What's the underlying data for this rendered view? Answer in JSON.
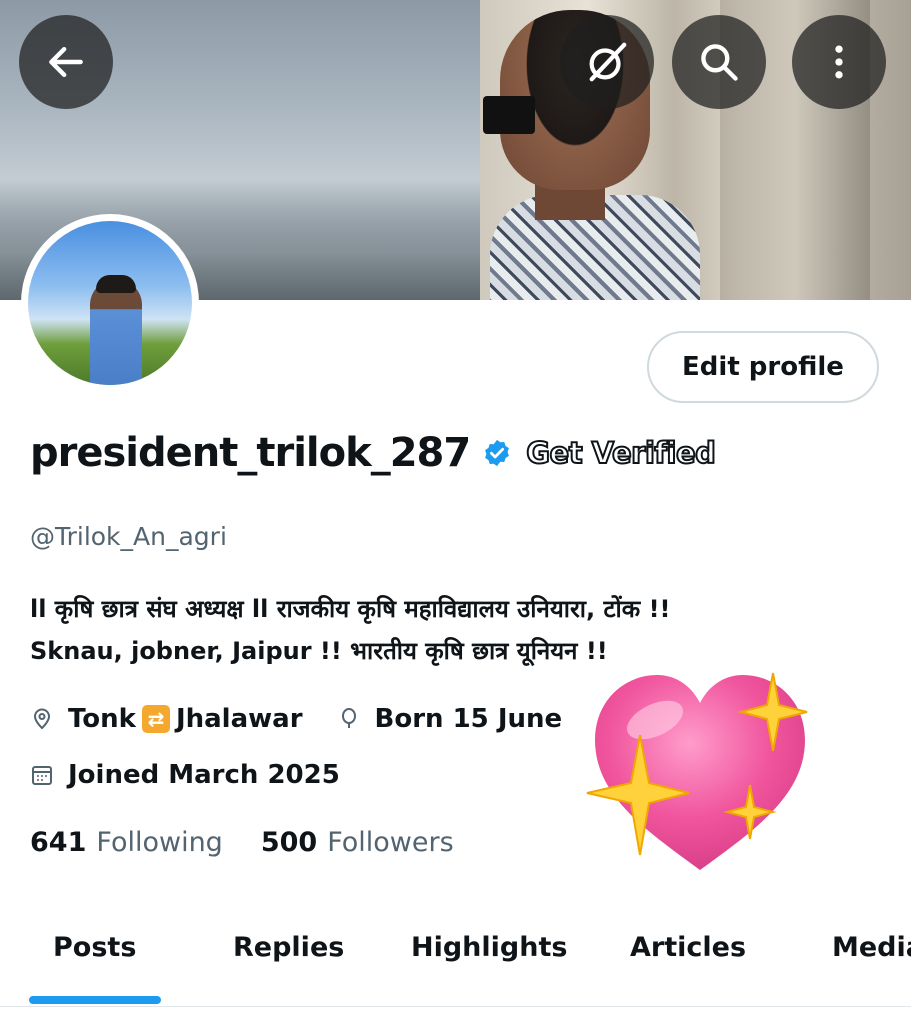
{
  "header": {
    "back_icon": "arrow-left-icon",
    "grok_icon": "grok-slash-icon",
    "search_icon": "search-icon",
    "more_icon": "more-vertical-icon"
  },
  "profile": {
    "edit_label": "Edit profile",
    "display_name": "president_trilok_287",
    "get_verified": "Get Verified",
    "handle": "@Trilok_An_agri",
    "bio_line1": "ll कृषि छात्र संघ अध्यक्ष  ll  राजकीय कृषि महाविद्यालय उनियारा, टोंक  !!",
    "bio_line2": "Sknau, jobner, Jaipur  !! भारतीय कृषि छात्र यूनियन  !!",
    "location_a": "Tonk",
    "location_b": "Jhalawar",
    "born": "Born 15 June",
    "joined": "Joined March 2025",
    "following_count": "641",
    "following_label": "Following",
    "followers_count": "500",
    "followers_label": "Followers"
  },
  "tabs": [
    {
      "label": "Posts",
      "active": true
    },
    {
      "label": "Replies"
    },
    {
      "label": "Highlights"
    },
    {
      "label": "Articles"
    },
    {
      "label": "Media"
    }
  ],
  "colors": {
    "accent": "#1d9bf0",
    "text": "#0f1419",
    "muted": "#536471",
    "heart": "#f0559d"
  }
}
